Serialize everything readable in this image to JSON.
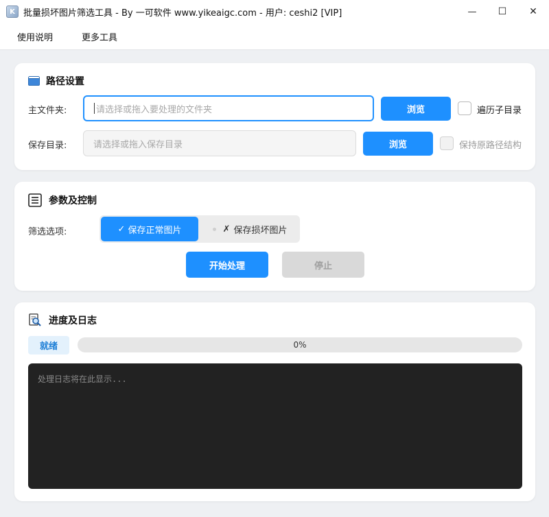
{
  "window": {
    "title": "批量损坏图片筛选工具 - By 一可软件 www.yikeaigc.com - 用户: ceshi2 [VIP]",
    "icon_glyph": "K",
    "controls": {
      "minimize": "—",
      "maximize": "☐",
      "close": "✕"
    }
  },
  "menu": {
    "items": [
      "使用说明",
      "更多工具"
    ]
  },
  "path_settings": {
    "title": "路径设置",
    "icon": "folder-icon",
    "main_folder": {
      "label": "主文件夹:",
      "placeholder": "请选择或拖入要处理的文件夹",
      "browse_label": "浏览",
      "checkbox_label": "遍历子目录",
      "checked": false
    },
    "save_dir": {
      "label": "保存目录:",
      "placeholder": "请选择或拖入保存目录",
      "browse_label": "浏览",
      "checkbox_label": "保持原路径结构",
      "checked": false,
      "disabled": true
    }
  },
  "params": {
    "title": "参数及控制",
    "icon": "list-icon",
    "filter_label": "筛选选项:",
    "options": [
      {
        "label": "保存正常图片",
        "mark": "✓",
        "selected": true
      },
      {
        "label": "保存损坏图片",
        "mark": "✗",
        "selected": false
      }
    ],
    "start_label": "开始处理",
    "stop_label": "停止"
  },
  "progress": {
    "title": "进度及日志",
    "icon": "search-document-icon",
    "status": "就绪",
    "percent_text": "0%",
    "value": 0,
    "log_placeholder": "处理日志将在此显示..."
  },
  "colors": {
    "accent": "#1e90ff",
    "disabled": "#d9d9d9",
    "status_bg": "#e3f1fc",
    "log_bg": "#222222"
  }
}
